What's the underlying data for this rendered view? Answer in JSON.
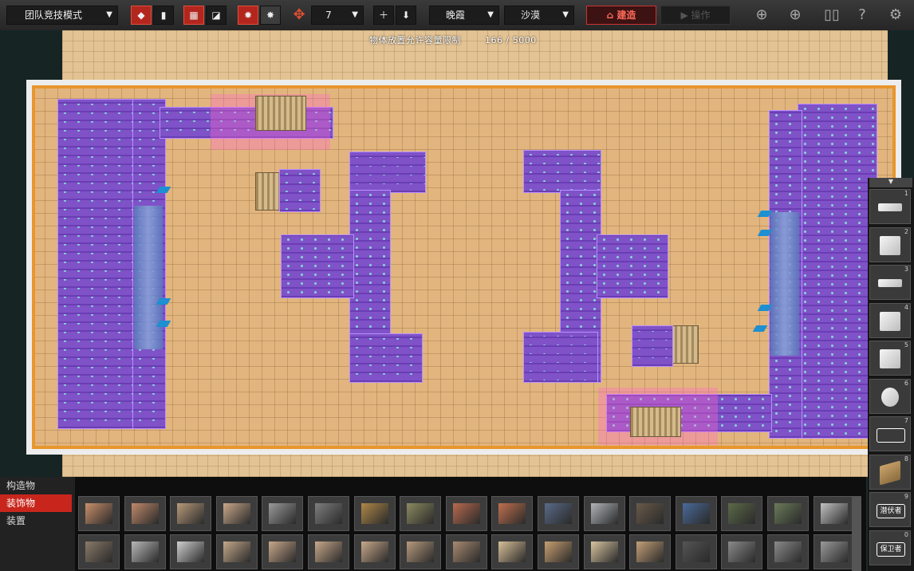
{
  "toolbar": {
    "mode": "团队竞技模式",
    "grid_size": "7",
    "time_of_day": "晚霞",
    "terrain": "沙漠",
    "build": "建造",
    "operate": "操作"
  },
  "status": {
    "capacity_label": "物体放置允许容量限制",
    "capacity_value": "166 / 5000"
  },
  "categories": [
    "构造物",
    "装饰物",
    "装置"
  ],
  "palette": [
    {
      "n": "1",
      "shape": "flat"
    },
    {
      "n": "2",
      "shape": "box"
    },
    {
      "n": "3",
      "shape": "flat"
    },
    {
      "n": "4",
      "shape": "box"
    },
    {
      "n": "5",
      "shape": "box"
    },
    {
      "n": "6",
      "shape": "cyl"
    },
    {
      "n": "7",
      "shape": "hex",
      "label": ""
    },
    {
      "n": "8",
      "shape": "ramp"
    },
    {
      "n": "9",
      "shape": "hex",
      "label": "潜伏者"
    },
    {
      "n": "0",
      "shape": "hex",
      "label": "保卫者"
    }
  ],
  "items": {
    "row1": [
      "#c98f6a",
      "#c0896a",
      "#b89a7a",
      "#c9a78a",
      "#9a9a9a",
      "#7e7e7e",
      "#b08848",
      "#8c8a60",
      "#b86a4e",
      "#c0704e",
      "#5a6a88",
      "#b0b4b8",
      "#6a5a4a",
      "#4a6a9a",
      "#5c6a48",
      "#6a7a5a",
      "#c2c2c2"
    ],
    "row2": [
      "#8a7a68",
      "#b8b8b8",
      "#cfcfcf",
      "#c4a88a",
      "#c8a88a",
      "#c8a88a",
      "#c8a88a",
      "#b89a7c",
      "#a88a70",
      "#d8c098",
      "#c8a070",
      "#d8c4a0",
      "#c4a078",
      "#555555",
      "#8a8a8a",
      "#8a8a8a",
      "#9a9a9a"
    ]
  },
  "colors": {
    "accent": "#c8261c",
    "wall": "#7f52c8",
    "sand": "#e2b57e"
  }
}
